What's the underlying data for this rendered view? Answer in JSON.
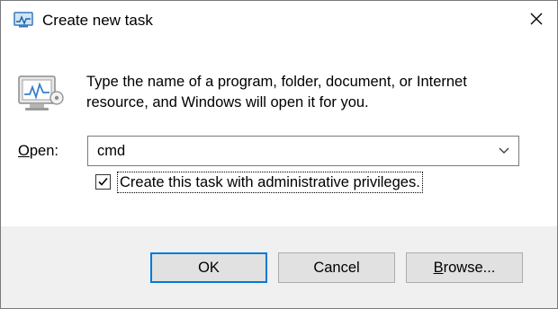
{
  "window": {
    "title": "Create new task",
    "title_icon": "task-manager-icon",
    "close_icon": "close-icon"
  },
  "message": {
    "icon": "run-program-icon",
    "line1": "Type the name of a program, folder, document, or Internet",
    "line2": "resource, and Windows will open it for you."
  },
  "open_field": {
    "label_accel": "O",
    "label_rest": "pen:",
    "value": "cmd",
    "dropdown_icon": "chevron-down-icon"
  },
  "admin_option": {
    "label": "Create this task with administrative privileges.",
    "checked": true
  },
  "buttons": {
    "ok": "OK",
    "cancel": "Cancel",
    "browse_accel": "B",
    "browse_rest": "rowse..."
  },
  "colors": {
    "focus_border": "#0078d7",
    "button_face": "#e1e1e1",
    "footer_bg": "#f0f0f0",
    "window_bg": "#ffffff"
  }
}
